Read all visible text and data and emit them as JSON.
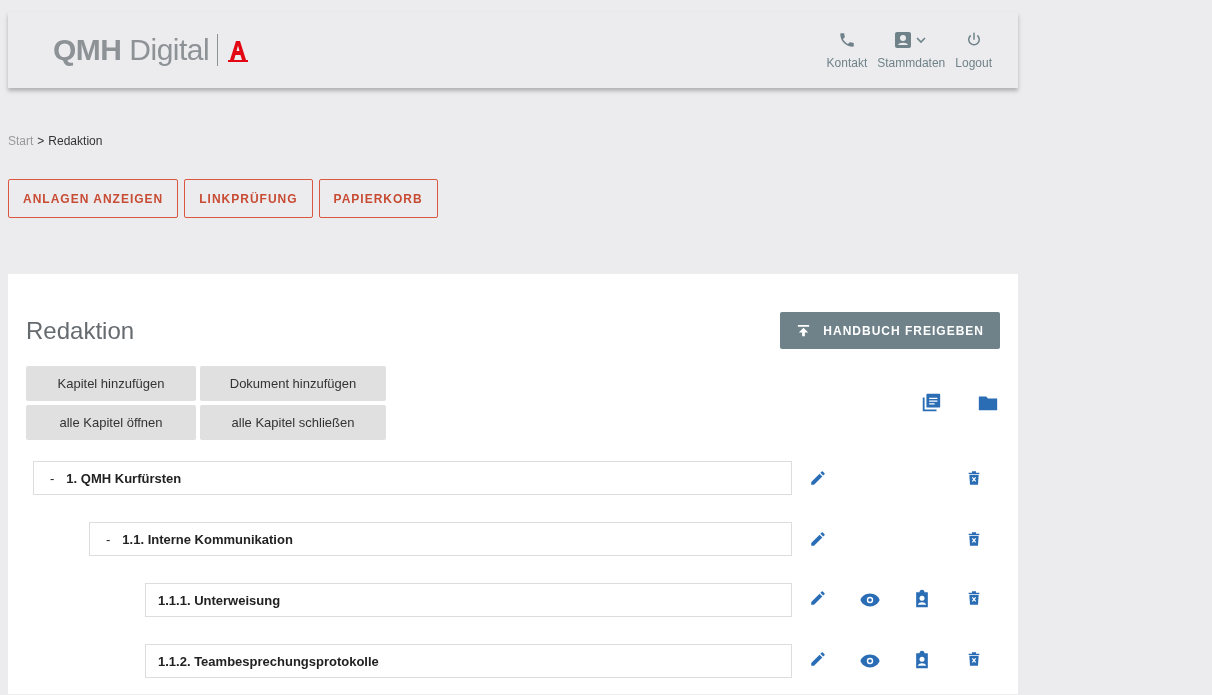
{
  "header": {
    "logo_bold": "QMH",
    "logo_light": "Digital",
    "nav": [
      {
        "kind": "phone",
        "label": "Kontakt"
      },
      {
        "kind": "profile",
        "label": "Stammdaten"
      },
      {
        "kind": "power",
        "label": "Logout"
      }
    ]
  },
  "breadcrumb": [
    {
      "label": "Start",
      "current": false
    },
    {
      "label": ">",
      "current": true
    },
    {
      "label": "Redaktion",
      "current": true
    }
  ],
  "actions": [
    "ANLAGEN ANZEIGEN",
    "LINKPRÜFUNG",
    "PAPIERKORB"
  ],
  "panel": {
    "title": "Redaktion",
    "publish_button": "HANDBUCH FREIGEBEN",
    "tools": [
      "Kapitel hinzufügen",
      "Dokument hinzufügen",
      "alle Kapitel öffnen",
      "alle Kapitel schließen"
    ],
    "tree": [
      {
        "kind": "chapter",
        "marker": "-",
        "label": "1. QMH Kurfürsten",
        "children": [
          {
            "kind": "chapter",
            "marker": "-",
            "label": "1.1. Interne Kommunikation",
            "children": [
              {
                "kind": "document",
                "label": "1.1.1. Unterweisung"
              },
              {
                "kind": "document",
                "label": "1.1.2. Teambesprechungsprotokolle"
              }
            ]
          }
        ]
      }
    ]
  }
}
